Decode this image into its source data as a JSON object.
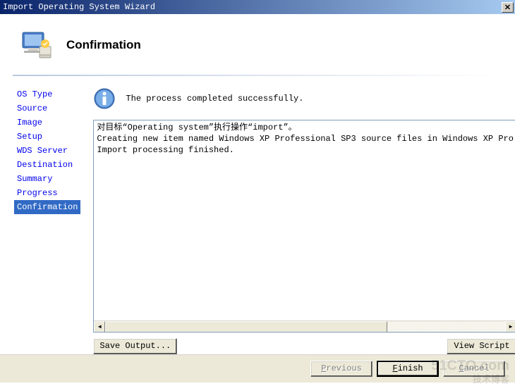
{
  "window": {
    "title": "Import Operating System Wizard"
  },
  "header": {
    "title": "Confirmation"
  },
  "sidebar": {
    "items": [
      {
        "label": "OS Type"
      },
      {
        "label": "Source"
      },
      {
        "label": "Image"
      },
      {
        "label": "Setup"
      },
      {
        "label": "WDS Server"
      },
      {
        "label": "Destination"
      },
      {
        "label": "Summary"
      },
      {
        "label": "Progress"
      },
      {
        "label": "Confirmation"
      }
    ],
    "active_index": 8
  },
  "main": {
    "status": "The process completed successfully.",
    "log": [
      "对目标“Operating system”执行操作“import”。",
      "Creating new item named Windows XP Professional SP3 source files in Windows XP Pro",
      "Import processing finished."
    ],
    "save_output_label": "Save Output...",
    "view_script_label": "View Script"
  },
  "footer": {
    "previous_label": "Previous",
    "finish_label": "Finish",
    "cancel_label": "Cancel"
  },
  "watermark": {
    "line1": "51CTO.com",
    "line2": "技术博客"
  }
}
